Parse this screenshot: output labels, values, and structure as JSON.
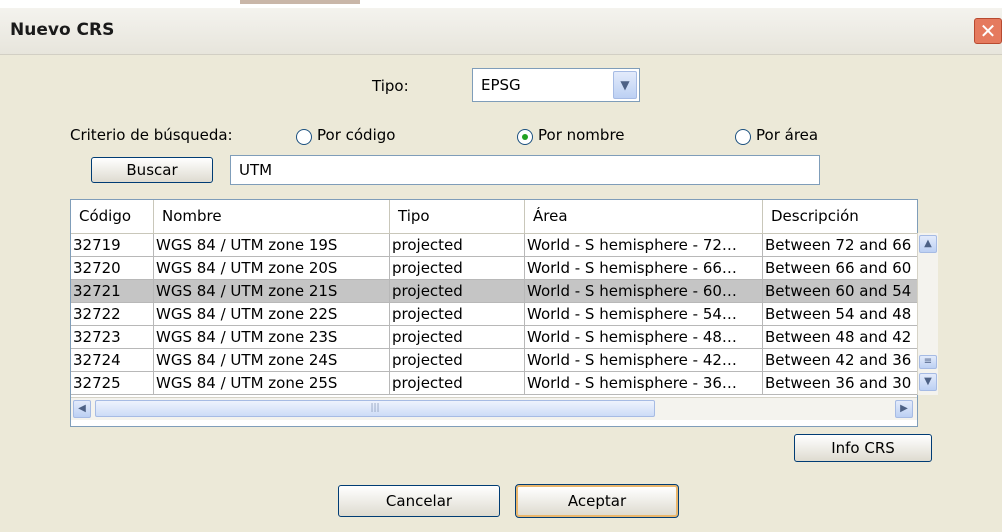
{
  "window": {
    "title": "Nuevo CRS",
    "close_icon": "✕"
  },
  "tipo": {
    "label": "Tipo:",
    "value": "EPSG"
  },
  "search": {
    "criteria_label": "Criterio de búsqueda:",
    "options": [
      "Por código",
      "Por nombre",
      "Por área"
    ],
    "selected": "Por nombre",
    "button_label": "Buscar",
    "query": "UTM"
  },
  "table": {
    "columns": [
      "Código",
      "Nombre",
      "Tipo",
      "Área",
      "Descripción"
    ],
    "rows": [
      [
        "32719",
        "WGS 84 / UTM zone 19S",
        "projected",
        "World - S hemisphere - 72…",
        "Between 72 and 66"
      ],
      [
        "32720",
        "WGS 84 / UTM zone 20S",
        "projected",
        "World - S hemisphere - 66…",
        "Between 66 and 60"
      ],
      [
        "32721",
        "WGS 84 / UTM zone 21S",
        "projected",
        "World - S hemisphere - 60…",
        "Between 60 and 54"
      ],
      [
        "32722",
        "WGS 84 / UTM zone 22S",
        "projected",
        "World - S hemisphere - 54…",
        "Between 54 and 48"
      ],
      [
        "32723",
        "WGS 84 / UTM zone 23S",
        "projected",
        "World - S hemisphere - 48…",
        "Between 48 and 42"
      ],
      [
        "32724",
        "WGS 84 / UTM zone 24S",
        "projected",
        "World - S hemisphere - 42…",
        "Between 42 and 36"
      ],
      [
        "32725",
        "WGS 84 / UTM zone 25S",
        "projected",
        "World - S hemisphere - 36…",
        "Between 36 and 30"
      ]
    ],
    "selected_row": 2
  },
  "buttons": {
    "info": "Info CRS",
    "cancel": "Cancelar",
    "accept": "Aceptar"
  },
  "icons": {
    "combo_arrow": "chevron-down-icon",
    "scroll_up": "chevron-up-icon",
    "scroll_down": "chevron-down-icon",
    "scroll_left": "chevron-left-icon",
    "scroll_right": "chevron-right-icon"
  }
}
